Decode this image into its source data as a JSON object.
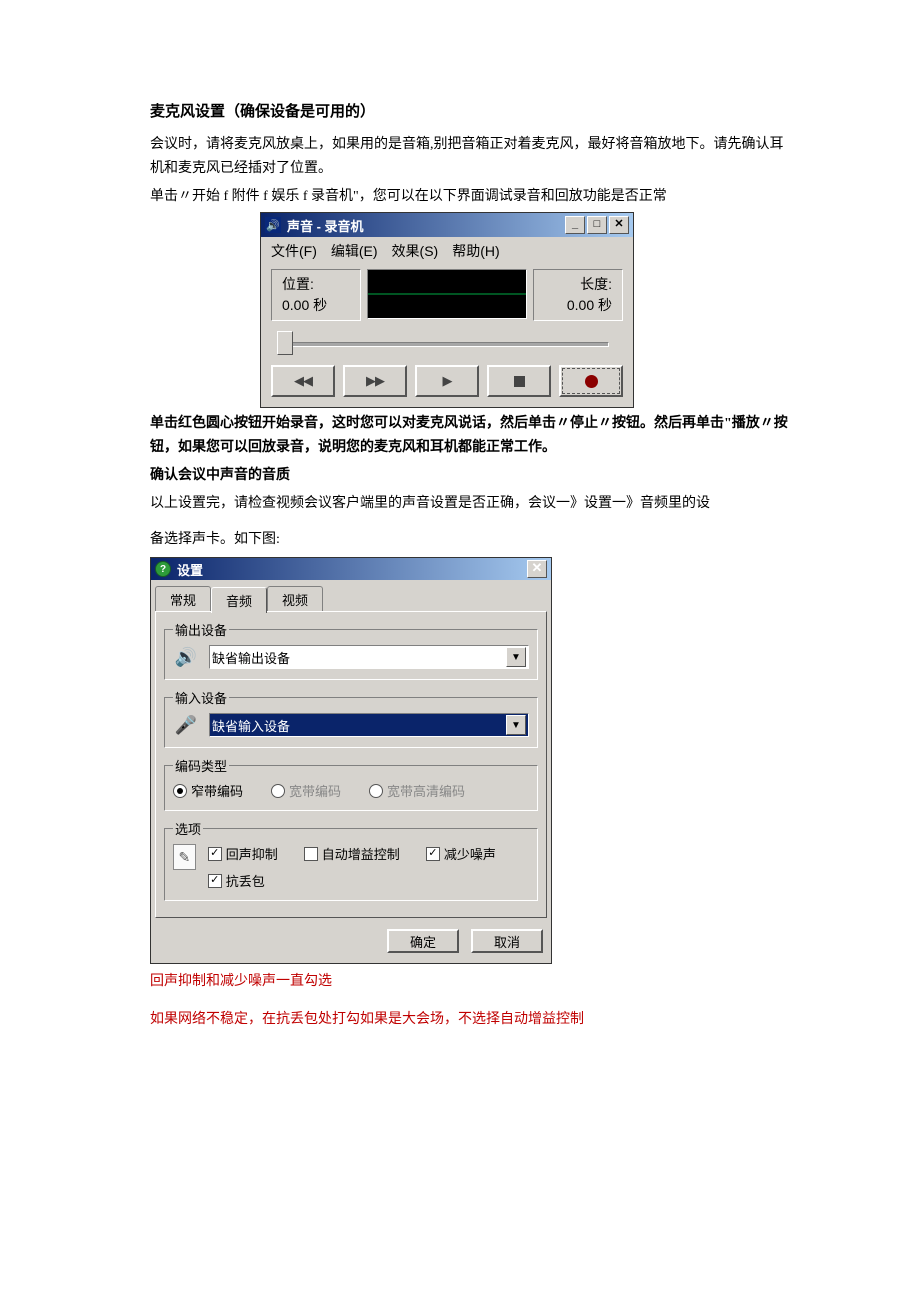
{
  "heading": "麦克风设置（确保设备是可用的）",
  "p1": "会议时，请将麦克风放桌上，如果用的是音箱,别把音箱正对着麦克风，最好将音箱放地下。请先确认耳机和麦克风已经插对了位置。",
  "p2": "单击〃开始 f 附件 f 娱乐 f 录音机\"，您可以在以下界面调试录音和回放功能是否正常",
  "recorder": {
    "title": "声音 - 录音机",
    "menu": {
      "file": "文件(F)",
      "edit": "编辑(E)",
      "effect": "效果(S)",
      "help": "帮助(H)"
    },
    "pos_label": "位置:",
    "pos_value": "0.00 秒",
    "len_label": "长度:",
    "len_value": "0.00 秒",
    "win_min": "_",
    "win_max": "□",
    "win_close": "✕"
  },
  "p3": "单击红色圆心按钮开始录音，这时您可以对麦克风说话，然后单击〃停止〃按钮。然后再单击\"播放〃按钮，如果您可以回放录音，说明您的麦克风和耳机都能正常工作。",
  "p4": "确认会议中声音的音质",
  "p5": "以上设置完，请检查视频会议客户端里的声音设置是否正确，会议一》设置一》音频里的设",
  "p6": "备选择声卡。如下图:",
  "settings": {
    "title": "设置",
    "tabs": {
      "general": "常规",
      "audio": "音频",
      "video": "视频"
    },
    "output_legend": "输出设备",
    "output_value": "缺省输出设备",
    "input_legend": "输入设备",
    "input_value": "缺省输入设备",
    "codec_legend": "编码类型",
    "codec_narrow": "窄带编码",
    "codec_wide": "宽带编码",
    "codec_hd": "宽带高清编码",
    "options_legend": "选项",
    "echo": "回声抑制",
    "agc": "自动增益控制",
    "noise": "减少噪声",
    "loss": "抗丢包",
    "ok": "确定",
    "cancel": "取消",
    "close": "✕"
  },
  "note1": "回声抑制和减少噪声一直勾选",
  "note2": "如果网络不稳定，在抗丢包处打勾如果是大会场，不选择自动增益控制"
}
